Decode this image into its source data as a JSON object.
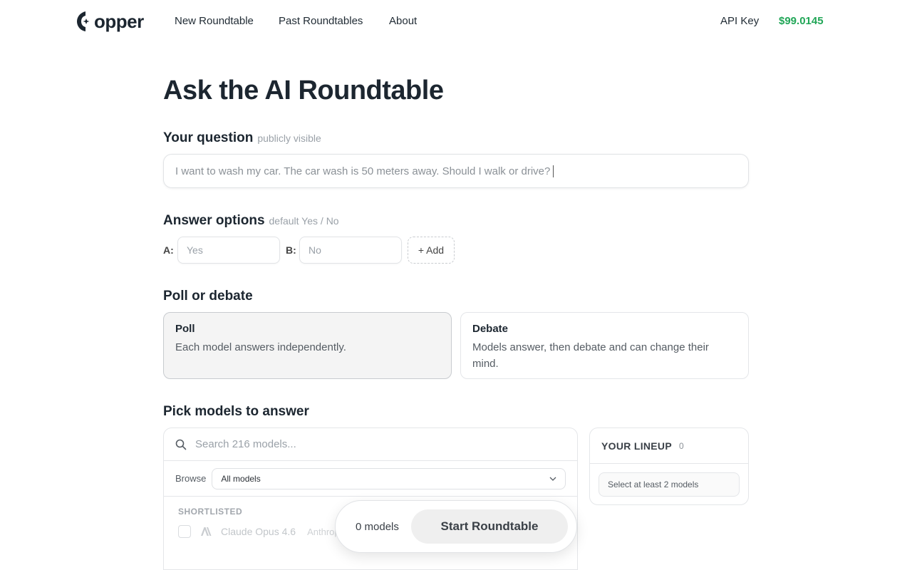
{
  "header": {
    "logo_text": "opper",
    "nav": [
      "New Roundtable",
      "Past Roundtables",
      "About"
    ],
    "api_key_label": "API Key",
    "balance": "$99.0145",
    "balance_color": "#21a657"
  },
  "page": {
    "title": "Ask the AI Roundtable"
  },
  "question": {
    "label": "Your question",
    "hint": "publicly visible",
    "value": "I want to wash my car. The car wash is 50 meters away. Should I walk or drive?"
  },
  "answer_options": {
    "label": "Answer options",
    "hint": "default Yes / No",
    "a_label": "A:",
    "a_placeholder": "Yes",
    "b_label": "B:",
    "b_placeholder": "No",
    "add_label": "+ Add"
  },
  "mode": {
    "label": "Poll or debate",
    "selected": "Poll",
    "options": [
      {
        "name": "Poll",
        "desc": "Each model answers independently."
      },
      {
        "name": "Debate",
        "desc": "Models answer, then debate and can change their mind."
      }
    ]
  },
  "models": {
    "label": "Pick models to answer",
    "search_placeholder": "Search 216 models...",
    "browse_label": "Browse",
    "browse_value": "All models",
    "shortlisted_header": "SHORTLISTED",
    "shortlisted": [
      {
        "name": "Claude Opus 4.6",
        "provider": "Anthropic",
        "icon": "anthropic-logo-icon"
      }
    ]
  },
  "lineup": {
    "title": "YOUR LINEUP",
    "count": "0",
    "empty_text": "Select at least 2 models"
  },
  "action_bar": {
    "models_count": "0 models",
    "start_label": "Start Roundtable"
  }
}
